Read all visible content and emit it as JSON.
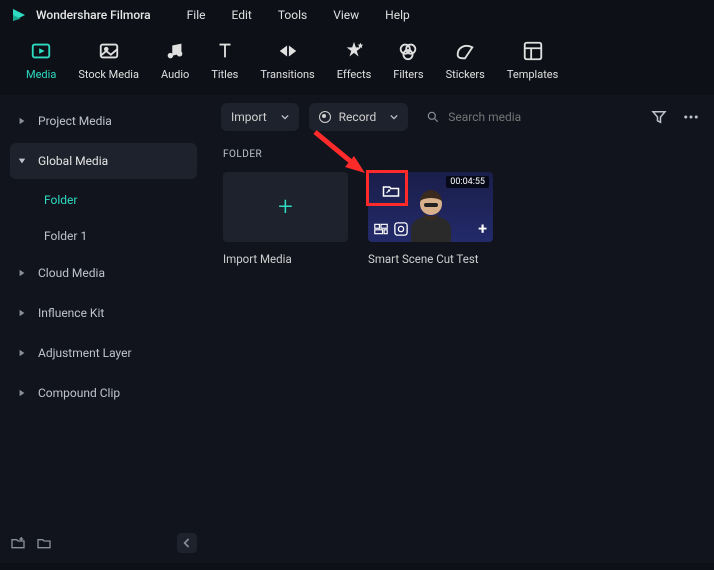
{
  "app_name": "Wondershare Filmora",
  "menubar": [
    "File",
    "Edit",
    "Tools",
    "View",
    "Help"
  ],
  "tabs": [
    {
      "label": "Media",
      "active": true
    },
    {
      "label": "Stock Media"
    },
    {
      "label": "Audio"
    },
    {
      "label": "Titles"
    },
    {
      "label": "Transitions"
    },
    {
      "label": "Effects"
    },
    {
      "label": "Filters"
    },
    {
      "label": "Stickers"
    },
    {
      "label": "Templates"
    }
  ],
  "sidebar": {
    "items": [
      {
        "label": "Project Media",
        "expanded": false
      },
      {
        "label": "Global Media",
        "expanded": true,
        "selected": true,
        "children": [
          {
            "label": "Folder",
            "active": true
          },
          {
            "label": "Folder 1"
          }
        ]
      },
      {
        "label": "Cloud Media"
      },
      {
        "label": "Influence Kit"
      },
      {
        "label": "Adjustment Layer"
      },
      {
        "label": "Compound Clip"
      }
    ]
  },
  "toolbar": {
    "import_label": "Import",
    "record_label": "Record",
    "search_placeholder": "Search media"
  },
  "section_label": "FOLDER",
  "cards": {
    "import_label": "Import Media",
    "clip": {
      "label": "Smart Scene Cut Test",
      "duration": "00:04:55"
    }
  }
}
